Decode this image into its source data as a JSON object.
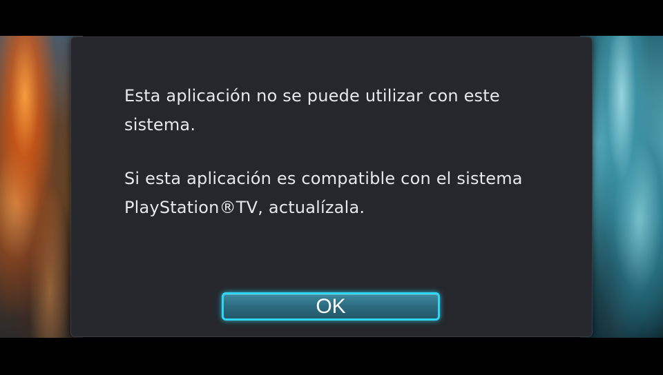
{
  "dialog": {
    "message_line1": "Esta aplicación no se puede utilizar con este sistema.",
    "message_line2": "Si esta aplicación es compatible con el sistema PlayStation®TV, actualízala.",
    "ok_label": "OK"
  },
  "colors": {
    "dialog_bg": "#25272c",
    "text": "#e6e8ec",
    "button_border": "#2fd6f5",
    "button_fill": "#2c6b80"
  },
  "icons": {
    "background_left": "fire-artwork",
    "background_right": "water-artwork"
  }
}
